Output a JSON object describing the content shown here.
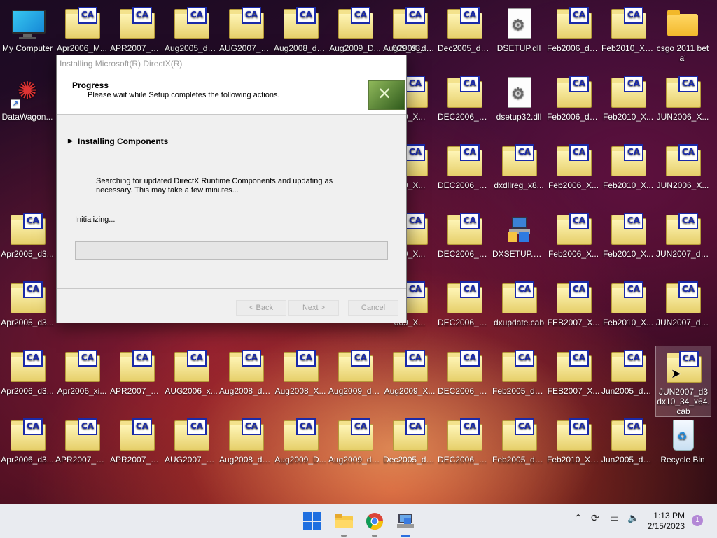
{
  "desktop": {
    "icons": [
      {
        "label": "My Computer",
        "kind": "computer"
      },
      {
        "label": "Apr2006_M...",
        "kind": "cab"
      },
      {
        "label": "APR2007_d3...",
        "kind": "cab"
      },
      {
        "label": "Aug2005_d3...",
        "kind": "cab"
      },
      {
        "label": "AUG2007_d...",
        "kind": "cab"
      },
      {
        "label": "Aug2008_d3...",
        "kind": "cab"
      },
      {
        "label": "Aug2009_D...",
        "kind": "cab"
      },
      {
        "label": "Aug2009_d3...",
        "kind": "cab"
      },
      {
        "label": "Dec2005_d3...",
        "kind": "cab"
      },
      {
        "label": "DSETUP.dll",
        "kind": "dll"
      },
      {
        "label": "Feb2006_d3...",
        "kind": "cab"
      },
      {
        "label": "Feb2010_X3...",
        "kind": "cab"
      },
      {
        "label": "csgo 2011 beta'",
        "kind": "folder"
      },
      {
        "label": "DataWagon...",
        "kind": "datawagon"
      },
      {
        "label": "DEC2006_d3...",
        "kind": "cab"
      },
      {
        "label": "dsetup32.dll",
        "kind": "dll"
      },
      {
        "label": "Feb2006_d3...",
        "kind": "cab"
      },
      {
        "label": "Feb2010_X...",
        "kind": "cab"
      },
      {
        "label": "JUN2006_X...",
        "kind": "cab"
      },
      {
        "label": "DEC2006_d3...",
        "kind": "cab"
      },
      {
        "label": "dxdllreg_x8...",
        "kind": "cab"
      },
      {
        "label": "Feb2006_X...",
        "kind": "cab"
      },
      {
        "label": "Feb2010_X...",
        "kind": "cab"
      },
      {
        "label": "JUN2006_X...",
        "kind": "cab"
      },
      {
        "label": "Apr2005_d3...",
        "kind": "cab"
      },
      {
        "label": "DEC2006_d3...",
        "kind": "cab"
      },
      {
        "label": "DXSETUP.exe",
        "kind": "exe"
      },
      {
        "label": "Feb2006_X...",
        "kind": "cab"
      },
      {
        "label": "Feb2010_X...",
        "kind": "cab"
      },
      {
        "label": "JUN2007_d3...",
        "kind": "cab"
      },
      {
        "label": "Apr2005_d3...",
        "kind": "cab"
      },
      {
        "label": "DEC2006_d3...",
        "kind": "cab"
      },
      {
        "label": "dxupdate.cab",
        "kind": "cab"
      },
      {
        "label": "FEB2007_X...",
        "kind": "cab"
      },
      {
        "label": "Feb2010_X...",
        "kind": "cab"
      },
      {
        "label": "JUN2007_d3...",
        "kind": "cab"
      },
      {
        "label": "Apr2006_d3...",
        "kind": "cab"
      },
      {
        "label": "Apr2006_xi...",
        "kind": "cab"
      },
      {
        "label": "APR2007_xi...",
        "kind": "cab"
      },
      {
        "label": "AUG2006_x...",
        "kind": "cab"
      },
      {
        "label": "Aug2008_d3...",
        "kind": "cab"
      },
      {
        "label": "Aug2008_X...",
        "kind": "cab"
      },
      {
        "label": "Aug2009_d3...",
        "kind": "cab"
      },
      {
        "label": "Aug2009_X...",
        "kind": "cab"
      },
      {
        "label": "DEC2006_X...",
        "kind": "cab"
      },
      {
        "label": "Feb2005_d3...",
        "kind": "cab"
      },
      {
        "label": "FEB2007_X...",
        "kind": "cab"
      },
      {
        "label": "Jun2005_d3...",
        "kind": "cab"
      },
      {
        "label": "JUN2007_d3dx10_34_x64.cab",
        "kind": "cab"
      },
      {
        "label": "Apr2006_d3...",
        "kind": "cab"
      },
      {
        "label": "APR2007_d3...",
        "kind": "cab"
      },
      {
        "label": "APR2007_xi...",
        "kind": "cab"
      },
      {
        "label": "AUG2007_d...",
        "kind": "cab"
      },
      {
        "label": "Aug2008_d3...",
        "kind": "cab"
      },
      {
        "label": "Aug2009_D...",
        "kind": "cab"
      },
      {
        "label": "Aug2009_d3...",
        "kind": "cab"
      },
      {
        "label": "Dec2005_d3...",
        "kind": "cab"
      },
      {
        "label": "DEC2006_X...",
        "kind": "cab"
      },
      {
        "label": "Feb2005_d3...",
        "kind": "cab"
      },
      {
        "label": "Feb2010_X3...",
        "kind": "cab"
      },
      {
        "label": "Jun2005_d3...",
        "kind": "cab"
      },
      {
        "label": "Recycle Bin",
        "kind": "recycle"
      },
      {
        "label": "009_X...",
        "kind": "cab"
      },
      {
        "label": "009_X...",
        "kind": "cab"
      },
      {
        "label": "009_X...",
        "kind": "cab"
      },
      {
        "label": "009_X...",
        "kind": "cab"
      },
      {
        "label": "009_d3...",
        "kind": "cab"
      }
    ],
    "cab_badge": "CA"
  },
  "dialog": {
    "title": "Installing Microsoft(R) DirectX(R)",
    "header_title": "Progress",
    "header_subtitle": "Please wait while Setup completes the following actions.",
    "section_title": "Installing Components",
    "description": "Searching for updated DirectX Runtime Components and updating as necessary. This may take a few minutes...",
    "status": "Initializing...",
    "progress": 0,
    "buttons": {
      "back": "< Back",
      "next": "Next >",
      "cancel": "Cancel"
    }
  },
  "taskbar": {
    "time": "1:13 PM",
    "date": "2/15/2023",
    "notification_count": "1",
    "apps": [
      "start-icon",
      "file-explorer-icon",
      "chrome-icon",
      "network-setup-icon"
    ],
    "tray_icons": [
      "chevron-up-icon",
      "sync-icon",
      "display-icon",
      "volume-icon"
    ]
  },
  "colors": {
    "cab_border": "#1a2aa8",
    "progress_fill": "#06b025",
    "windows_blue": "#1f6fe0"
  }
}
